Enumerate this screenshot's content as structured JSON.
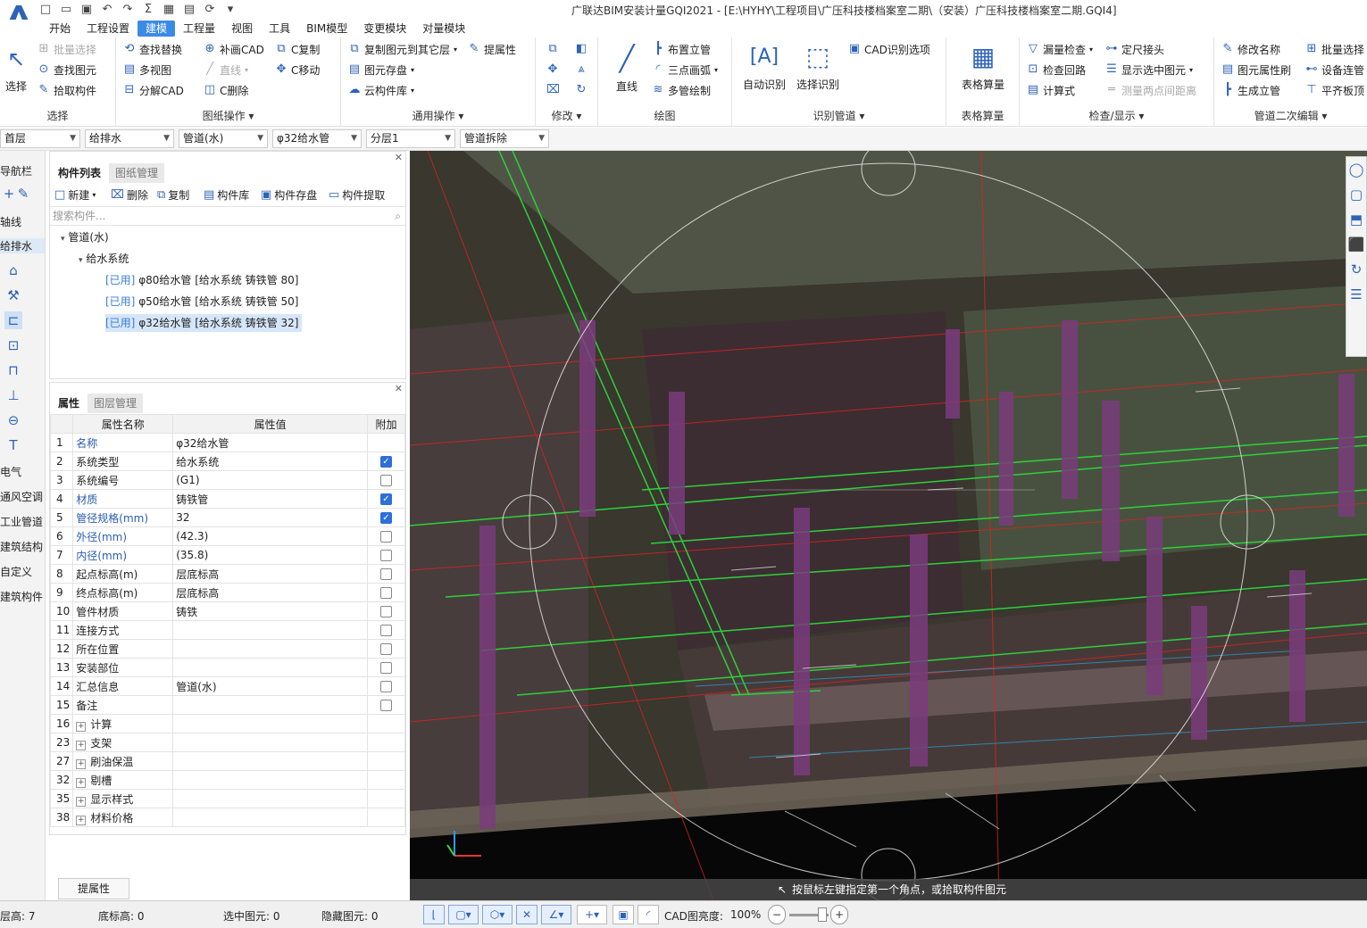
{
  "app": {
    "title": "广联达BIM安装计量GQI2021 - [E:\\HYHY\\工程项目\\广压科技楼档案室二期\\（安装）广压科技楼档案室二期.GQI4]"
  },
  "menus": [
    "开始",
    "工程设置",
    "建模",
    "工程量",
    "视图",
    "工具",
    "BIM模型",
    "变更模块",
    "对量模块"
  ],
  "ribbon": {
    "select": {
      "label": "选择",
      "big": "选择",
      "items": [
        "批量选择",
        "查找图元",
        "拾取构件"
      ]
    },
    "drawing_ops": {
      "label": "图纸操作",
      "items": [
        "查找替换",
        "补画CAD",
        "C复制",
        "多视图",
        "直线",
        "C移动",
        "分解CAD",
        "C删除"
      ]
    },
    "general_ops": {
      "label": "通用操作",
      "items": [
        "复制图元到其它层",
        "提属性",
        "图元存盘",
        "云构件库"
      ]
    },
    "modify": {
      "label": "修改"
    },
    "draw": {
      "label": "绘图",
      "big": "直线",
      "items": [
        "布置立管",
        "三点画弧",
        "多管绘制"
      ]
    },
    "identify": {
      "label": "识别管道",
      "auto": "自动识别",
      "select": "选择识别",
      "cad_option": "CAD识别选项"
    },
    "table_calc": {
      "label": "表格算量",
      "big": "表格算量"
    },
    "check": {
      "label": "检查/显示",
      "items": [
        "漏量检查",
        "定尺接头",
        "检查回路",
        "显示选中图元",
        "计算式",
        "测量两点间距离"
      ]
    },
    "pipe_edit": {
      "label": "管道二次编辑",
      "items": [
        "修改名称",
        "批量选择",
        "图元属性刷",
        "设备连管",
        "生成立管",
        "平齐板顶"
      ]
    }
  },
  "filters": [
    "首层",
    "给排水",
    "管道(水)",
    "φ32给水管",
    "分层1",
    "管道拆除"
  ],
  "nav": {
    "title": "导航栏",
    "items": [
      "轴线",
      "给排水",
      "电气",
      "通风空调",
      "工业管道",
      "建筑结构",
      "自定义",
      "建筑构件"
    ]
  },
  "component_panel": {
    "tabs": [
      "构件列表",
      "图纸管理"
    ],
    "tools": [
      "新建",
      "删除",
      "复制",
      "构件库",
      "构件存盘",
      "构件提取"
    ],
    "search_placeholder": "搜索构件...",
    "tree": {
      "root": "管道(水)",
      "system": "给水系统",
      "used_tag": "[已用]",
      "items": [
        "φ80给水管 [给水系统 铸铁管 80]",
        "φ50给水管 [给水系统 铸铁管 50]",
        "φ32给水管 [给水系统 铸铁管 32]"
      ]
    }
  },
  "property_panel": {
    "tabs": [
      "属性",
      "图层管理"
    ],
    "headers": [
      "属性名称",
      "属性值",
      "附加"
    ],
    "rows": [
      {
        "n": "1",
        "name": "名称",
        "value": "φ32给水管",
        "blue": true,
        "check": null
      },
      {
        "n": "2",
        "name": "系统类型",
        "value": "给水系统",
        "blue": false,
        "check": true
      },
      {
        "n": "3",
        "name": "系统编号",
        "value": "(G1)",
        "blue": false,
        "check": false
      },
      {
        "n": "4",
        "name": "材质",
        "value": "铸铁管",
        "blue": true,
        "check": true
      },
      {
        "n": "5",
        "name": "管径规格(mm)",
        "value": "32",
        "blue": true,
        "check": true
      },
      {
        "n": "6",
        "name": "外径(mm)",
        "value": "(42.3)",
        "blue": true,
        "check": false
      },
      {
        "n": "7",
        "name": "内径(mm)",
        "value": "(35.8)",
        "blue": true,
        "check": false
      },
      {
        "n": "8",
        "name": "起点标高(m)",
        "value": "层底标高",
        "blue": false,
        "check": false
      },
      {
        "n": "9",
        "name": "终点标高(m)",
        "value": "层底标高",
        "blue": false,
        "check": false
      },
      {
        "n": "10",
        "name": "管件材质",
        "value": "铸铁",
        "blue": false,
        "check": false
      },
      {
        "n": "11",
        "name": "连接方式",
        "value": "",
        "blue": false,
        "check": false
      },
      {
        "n": "12",
        "name": "所在位置",
        "value": "",
        "blue": false,
        "check": false
      },
      {
        "n": "13",
        "name": "安装部位",
        "value": "",
        "blue": false,
        "check": false
      },
      {
        "n": "14",
        "name": "汇总信息",
        "value": "管道(水)",
        "blue": false,
        "check": false
      },
      {
        "n": "15",
        "name": "备注",
        "value": "",
        "blue": false,
        "check": false
      }
    ],
    "groups": [
      {
        "n": "16",
        "name": "计算"
      },
      {
        "n": "23",
        "name": "支架"
      },
      {
        "n": "27",
        "name": "刷油保温"
      },
      {
        "n": "32",
        "name": "剔槽"
      },
      {
        "n": "35",
        "name": "显示样式"
      },
      {
        "n": "38",
        "name": "材料价格"
      }
    ],
    "get_prop_button": "提属性"
  },
  "viewport": {
    "hint": "按鼠标左键指定第一个角点，或拾取构件图元"
  },
  "statusbar": {
    "floor_height": "层高: 7",
    "bottom_elev": "底标高: 0",
    "selected": "选中图元: 0",
    "hidden": "隐藏图元: 0",
    "cad_brightness_label": "CAD图亮度:",
    "cad_brightness_value": "100%"
  }
}
